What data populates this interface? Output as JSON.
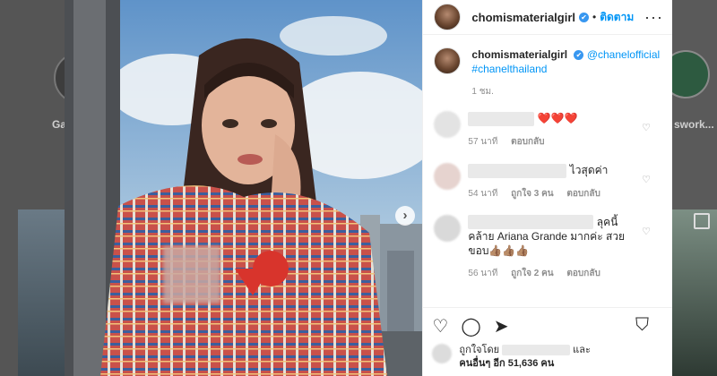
{
  "background": {
    "left_label": "Ga",
    "right_label": "swork..."
  },
  "post": {
    "next_glyph": "›",
    "header": {
      "username": "chomismaterialgirl",
      "verified_glyph": "✔",
      "separator": "•",
      "follow_label": "ติดตาม",
      "more_glyph": "···"
    },
    "caption": {
      "username": "chomismaterialgirl",
      "verified_glyph": "✔",
      "mention": "@chanelofficial",
      "hashtag": "#chanelthailand",
      "time": "1 ชม."
    },
    "comments": [
      {
        "text": "❤️❤️❤️",
        "time": "57 นาที",
        "likes": "",
        "reply": "ตอบกลับ"
      },
      {
        "text": "ไวสุดค่า",
        "time": "54 นาที",
        "likes": "ถูกใจ 3 คน",
        "reply": "ตอบกลับ"
      },
      {
        "line1": "ลุคนี้",
        "line2": "คล้าย Ariana Grande มากค่ะ สวย",
        "line3": "ขอบ👍🏽👍🏽👍🏽",
        "time": "56 นาที",
        "likes": "ถูกใจ 2 คน",
        "reply": "ตอบกลับ"
      }
    ],
    "likes": {
      "prefix": "ถูกใจโดย",
      "and": "และ",
      "others": "คนอื่นๆ อีก 51,636 คน"
    },
    "colors": {
      "accent": "#0095f6",
      "verified": "#3897f0",
      "text": "#262626",
      "muted": "#8e8e8e"
    },
    "icons": [
      "like-icon",
      "comment-icon",
      "share-icon",
      "save-icon",
      "more-icon",
      "next-arrow-icon",
      "heart-icon"
    ]
  }
}
